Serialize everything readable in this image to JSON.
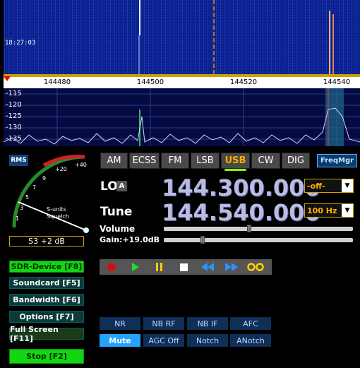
{
  "waterfall": {
    "time": "18:27:03"
  },
  "freq_scale": {
    "ticks": [
      "144480",
      "144500",
      "144520",
      "144540"
    ]
  },
  "spectrum": {
    "db_labels": [
      "-115",
      "-120",
      "-125",
      "-130",
      "-135"
    ]
  },
  "meter": {
    "rms_label": "RMS",
    "scale_labels": [
      "+40",
      "+20",
      "9",
      "7",
      "5",
      "3",
      "1"
    ],
    "s_units_label": "S-units",
    "squelch_label": "Squelch",
    "value": "S3 +2 dB"
  },
  "side_buttons": {
    "sdr_device": "SDR-Device [F8]",
    "soundcard": "Soundcard  [F5]",
    "bandwidth": "Bandwidth  [F6]",
    "options": "Options  [F7]",
    "full_screen": "Full Screen  [F11]",
    "stop": "Stop  [F2]"
  },
  "modes": [
    "AM",
    "ECSS",
    "FM",
    "LSB",
    "USB",
    "CW",
    "DIG"
  ],
  "active_mode": "USB",
  "freqmgr_label": "FreqMgr",
  "lo": {
    "label": "LO",
    "badge": "A",
    "frequency": "144.300.000",
    "select_value": "-off-"
  },
  "tune": {
    "label": "Tune",
    "frequency": "144.540.000",
    "step_value": "100 Hz"
  },
  "volume": {
    "label": "Volume",
    "level": 0.45
  },
  "gain": {
    "label": "Gain:+19.0dB",
    "level": 0.2
  },
  "dsp": {
    "nr": "NR",
    "nb_rf": "NB RF",
    "nb_if": "NB IF",
    "afc": "AFC",
    "mute": "Mute",
    "agc_off": "AGC Off",
    "notch": "Notch",
    "anotch": "ANotch"
  },
  "colors": {
    "accent": "#ffae00",
    "active_green": "#12d612",
    "waterfall_bg": "#0b1f8a"
  }
}
